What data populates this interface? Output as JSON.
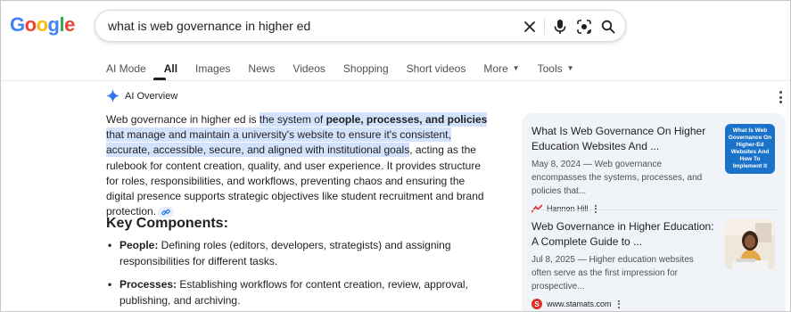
{
  "logo": {
    "text": "Google"
  },
  "search": {
    "query": "what is web governance in higher ed"
  },
  "tabs": [
    {
      "label": "AI Mode"
    },
    {
      "label": "All"
    },
    {
      "label": "Images"
    },
    {
      "label": "News"
    },
    {
      "label": "Videos"
    },
    {
      "label": "Shopping"
    },
    {
      "label": "Short videos"
    },
    {
      "label": "More"
    },
    {
      "label": "Tools"
    }
  ],
  "ai_overview": {
    "title": "AI Overview",
    "intro": "Web governance in higher ed is ",
    "hl_part1": "the system of ",
    "hl_bold": "people, processes, and policies",
    "hl_part2": " that manage and maintain a university's website to ensure it's consistent, accurate, accessible, secure, and aligned with institutional goals",
    "rest": ", acting as the rulebook for content creation, quality, and user experience. It provides structure for roles, responsibilities, and workflows, preventing chaos and ensuring the digital presence supports strategic objectives like student recruitment and brand protection.",
    "key_components_title": "Key Components:",
    "components": [
      {
        "label": "People:",
        "text": " Defining roles (editors, developers, strategists) and assigning responsibilities for different tasks."
      },
      {
        "label": "Processes:",
        "text": " Establishing workflows for content creation, review, approval, publishing, and archiving."
      }
    ]
  },
  "sources": [
    {
      "title": "What Is Web Governance On Higher Education Websites And ...",
      "snippet": "May 8, 2024 — Web governance encompasses the systems, processes, and policies that...",
      "site": "Hannon Hill",
      "thumb_text": "What Is Web Governance On Higher-Ed Websites And How To Implement It"
    },
    {
      "title": "Web Governance in Higher Education: A Complete Guide to ...",
      "snippet": "Jul 8, 2025 — Higher education websites often serve as the first impression for prospective...",
      "site": "www.stamats.com",
      "favicon_letter": "S"
    }
  ],
  "colors": {
    "highlight": "#d3e3fd",
    "accent_blue": "#1a73e8",
    "panel_bg": "#f0f4f9"
  }
}
